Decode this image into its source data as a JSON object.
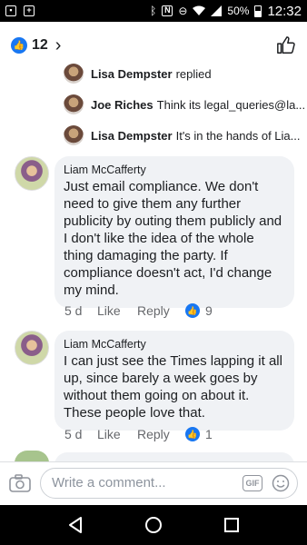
{
  "status_bar": {
    "battery": "50%",
    "time": "12:32",
    "left_icons": [
      "image-notification-icon",
      "plus-notification-icon"
    ],
    "right_icons": [
      "bluetooth-icon",
      "nfc-icon",
      "do-not-disturb-icon",
      "wifi-icon",
      "signal-icon",
      "battery-icon"
    ]
  },
  "header": {
    "like_count": "12"
  },
  "reply_previews": [
    {
      "name": "Lisa Dempster",
      "text": "replied"
    },
    {
      "name": "Joe Riches",
      "text": "Think its legal_queries@la..."
    },
    {
      "name": "Lisa Dempster",
      "text": "It's in the hands of Lia..."
    }
  ],
  "comments": [
    {
      "author": "Liam McCafferty",
      "body": "Just email compliance. We don't need to give them any further publicity by outing them publicly and I don't like the idea of the whole thing damaging the party. If compliance doesn't act, I'd change my mind.",
      "time": "5 d",
      "like_label": "Like",
      "reply_label": "Reply",
      "reaction_count": "9"
    },
    {
      "author": "Liam McCafferty",
      "body": "I can just see the Times lapping it all up, since barely a week goes by without them going on about it. These people love that.",
      "time": "5 d",
      "like_label": "Like",
      "reply_label": "Reply",
      "reaction_count": "1"
    }
  ],
  "composer": {
    "placeholder": "Write a comment...",
    "gif_label": "GIF"
  },
  "colors": {
    "accent": "#1877f2",
    "bubble": "#f0f2f5",
    "meta_text": "#65676b"
  }
}
